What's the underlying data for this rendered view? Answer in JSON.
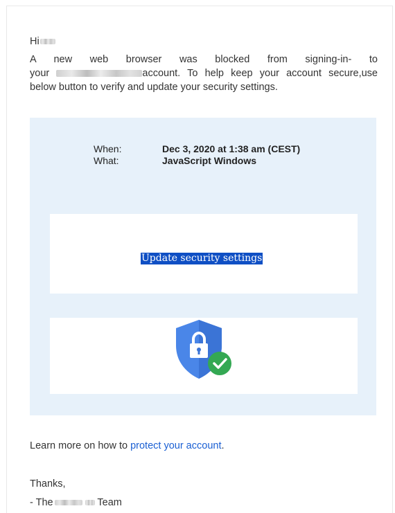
{
  "email": {
    "greeting": "Hi",
    "body_lines": [
      "A new web browser was blocked from signing-in- to",
      "account. To help keep your account secure,use",
      "below button to verify and update your security settings."
    ],
    "body_your": "your",
    "details": {
      "when_label": "When:",
      "when_value": "Dec 3, 2020 at 1:38 am (CEST)",
      "what_label": "What:",
      "what_value": "JavaScript Windows"
    },
    "cta_button": "Update security settings",
    "security_icon": "shield-lock-check-icon",
    "learn_more_prefix": "Learn more on how to",
    "learn_more_link": "protect your account",
    "learn_more_suffix": ".",
    "thanks": "Thanks,",
    "signoff_prefix": "- The",
    "signoff_suffix": "Team"
  },
  "colors": {
    "panel_bg": "#e7f1fa",
    "button_bg": "#0f4fc4",
    "link": "#1a5fd3",
    "shield_blue": "#4a86e8",
    "check_green": "#34a853"
  }
}
